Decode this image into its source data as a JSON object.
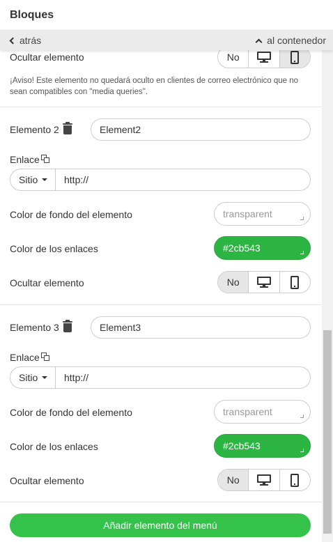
{
  "header": {
    "title": "Bloques"
  },
  "nav": {
    "back_label": "atrás",
    "up_label": "al contenedor"
  },
  "top_section": {
    "hide_label": "Ocultar elemento",
    "hide_no": "No",
    "warning": "¡Aviso! Este elemento no quedará oculto en clientes de correo electrónico que no sean compatibles con \"media queries\"."
  },
  "elements": [
    {
      "title": "Elemento 2",
      "name_value": "Element2",
      "link_label": "Enlace",
      "link_type": "Sitio",
      "link_value": "http://",
      "bg_label": "Color de fondo del elemento",
      "bg_value": "transparent",
      "link_color_label": "Color de los enlaces",
      "link_color_value": "#2cb543",
      "hide_label": "Ocultar elemento",
      "hide_no": "No"
    },
    {
      "title": "Elemento 3",
      "name_value": "Element3",
      "link_label": "Enlace",
      "link_type": "Sitio",
      "link_value": "http://",
      "bg_label": "Color de fondo del elemento",
      "bg_value": "transparent",
      "link_color_label": "Color de los enlaces",
      "link_color_value": "#2cb543",
      "hide_label": "Ocultar elemento",
      "hide_no": "No"
    }
  ],
  "add_button": {
    "label": "Añadir elemento del menú"
  },
  "colors": {
    "accent_green": "#2cb543",
    "button_green": "#35c24b"
  }
}
